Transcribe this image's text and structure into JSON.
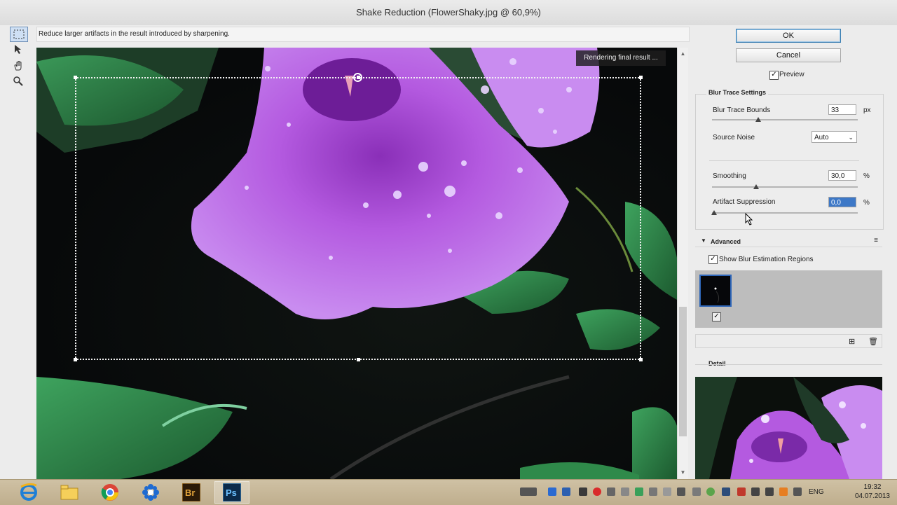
{
  "window": {
    "title": "Shake Reduction (FlowerShaky.jpg @ 60,9%)"
  },
  "hint_text": "Reduce larger artifacts in the result introduced by sharpening.",
  "tools": [
    {
      "name": "marquee-tool-icon"
    },
    {
      "name": "selection-tool-icon"
    },
    {
      "name": "hand-tool-icon"
    },
    {
      "name": "zoom-tool-icon"
    }
  ],
  "canvas": {
    "status": "Rendering final result ..."
  },
  "buttons": {
    "ok": "OK",
    "cancel": "Cancel"
  },
  "preview": {
    "label": "Preview",
    "checked": true
  },
  "blur_trace": {
    "title": "Blur Trace Settings",
    "bounds_label": "Blur Trace Bounds",
    "bounds_value": "33",
    "bounds_unit": "px",
    "noise_label": "Source Noise",
    "noise_value": "Auto",
    "smoothing_label": "Smoothing",
    "smoothing_value": "30,0",
    "smoothing_unit": "%",
    "artifact_label": "Artifact Suppression",
    "artifact_value": "0,0",
    "artifact_unit": "%"
  },
  "advanced": {
    "title": "Advanced",
    "show_regions_label": "Show Blur Estimation Regions",
    "show_regions_checked": true
  },
  "detail": {
    "title": "Detail"
  },
  "taskbar": {
    "time": "19:32",
    "date": "04.07.2013",
    "language": "ENG",
    "apps": [
      "Internet Explorer",
      "File Explorer",
      "Chrome",
      "Snowflake",
      "Bridge",
      "Photoshop"
    ]
  },
  "colors": {
    "petal": "#b45ae0",
    "leaf": "#2f8a4a",
    "accent": "#3d78c7"
  }
}
